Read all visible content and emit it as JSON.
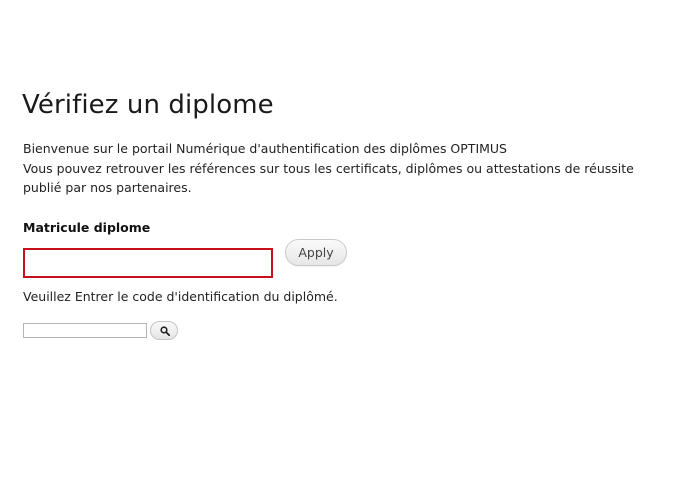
{
  "page": {
    "title": "Vérifiez un diplome",
    "intro_lines": [
      "Bienvenue sur le portail Numérique d'authentification des diplômes OPTIMUS",
      "Vous pouvez retrouver les références sur tous les certificats, diplômes ou attestations de réussite",
      "publié par nos partenaires."
    ]
  },
  "form": {
    "matricule_label": "Matricule diplome",
    "matricule_value": "",
    "apply_label": "Apply",
    "help_text": "Veuillez Entrer le code d'identification du diplômé."
  },
  "search": {
    "value": "",
    "icon": "search-icon"
  },
  "colors": {
    "input_error_border": "#c8101a",
    "text": "#222222"
  }
}
